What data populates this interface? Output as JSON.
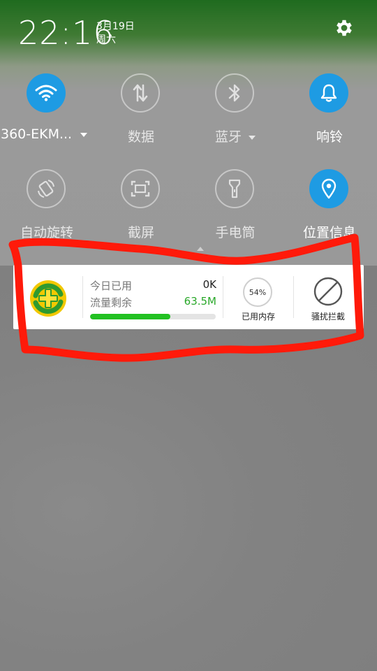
{
  "status_bar": {
    "time": "22:16",
    "date": "3月19日",
    "weekday": "周六",
    "settings_icon": "gear-icon"
  },
  "quick_settings": [
    {
      "label": "360-EKM...",
      "icon": "wifi-icon",
      "active": true,
      "has_dropdown": true
    },
    {
      "label": "数据",
      "icon": "mobile-data-icon",
      "active": false
    },
    {
      "label": "蓝牙",
      "icon": "bluetooth-icon",
      "active": false,
      "has_dropdown": true
    },
    {
      "label": "响铃",
      "icon": "bell-icon",
      "active": true
    },
    {
      "label": "自动旋转",
      "icon": "auto-rotate-icon",
      "active": false
    },
    {
      "label": "截屏",
      "icon": "screenshot-icon",
      "active": false
    },
    {
      "label": "手电筒",
      "icon": "flashlight-icon",
      "active": false
    },
    {
      "label": "位置信息",
      "icon": "location-icon",
      "active": true
    }
  ],
  "widget_360": {
    "logo_icon": "360-security-logo-icon",
    "today_used_label": "今日已用",
    "today_used_value": "0K",
    "data_remaining_label": "流量剩余",
    "data_remaining_value": "63.5M",
    "data_remaining_fraction": 0.64,
    "memory_percent": "54%",
    "memory_label": "已用内存",
    "block_label": "骚扰拦截",
    "block_icon": "block-icon"
  },
  "colors": {
    "accent_blue": "#1e9be3",
    "data_green": "#22c122",
    "annotation_red": "#ff1a0a"
  }
}
